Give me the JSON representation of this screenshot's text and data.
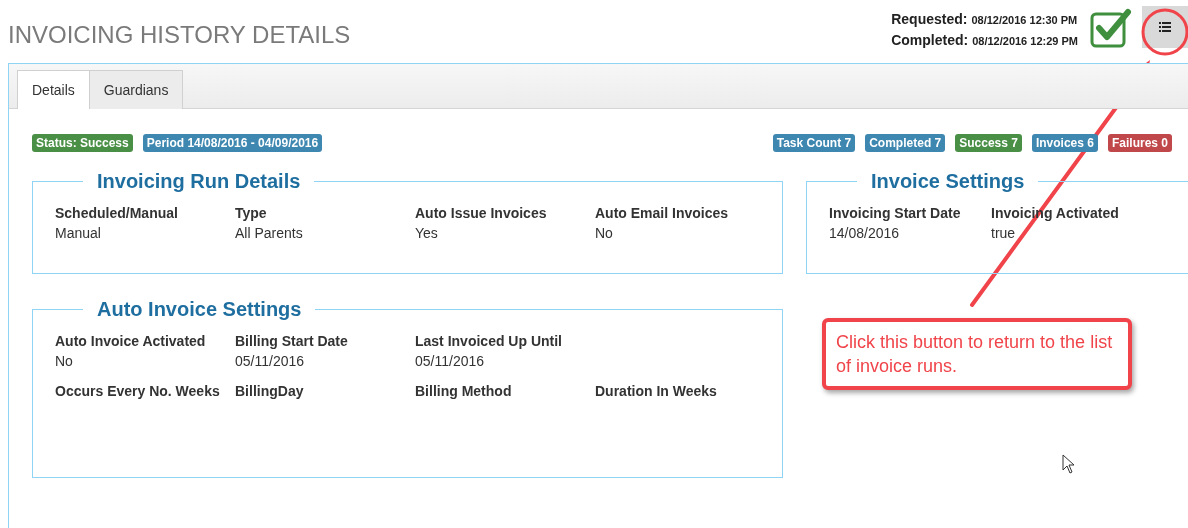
{
  "page_title": "INVOICING HISTORY DETAILS",
  "timestamps": [
    {
      "label": "Requested:",
      "value": "08/12/2016 12:30 PM"
    },
    {
      "label": "Completed:",
      "value": "08/12/2016 12:29 PM"
    }
  ],
  "tabs": [
    {
      "label": "Details",
      "selected": true
    },
    {
      "label": "Guardians",
      "selected": false
    }
  ],
  "status_badges": [
    {
      "text": "Status: Success",
      "color": "#4a8f46"
    },
    {
      "text": "Period 14/08/2016 - 04/09/2016",
      "color": "#3e87b0"
    }
  ],
  "count_badges": [
    {
      "text": "Task Count 7",
      "color": "#3e87b0"
    },
    {
      "text": "Completed 7",
      "color": "#3e87b0"
    },
    {
      "text": "Success 7",
      "color": "#4a8f46"
    },
    {
      "text": "Invoices 6",
      "color": "#3e87b0"
    },
    {
      "text": "Failures 0",
      "color": "#c0474a"
    }
  ],
  "left_sections": [
    {
      "title": "Invoicing Run Details",
      "rows": [
        [
          {
            "label": "Scheduled/Manual",
            "value": "Manual"
          },
          {
            "label": "Type",
            "value": "All Parents"
          },
          {
            "label": "Auto Issue Invoices",
            "value": "Yes"
          },
          {
            "label": "Auto Email Invoices",
            "value": "No"
          }
        ]
      ]
    },
    {
      "title": "Auto Invoice Settings",
      "rows": [
        [
          {
            "label": "Auto Invoice Activated",
            "value": "No"
          },
          {
            "label": "Billing Start Date",
            "value": "05/11/2016"
          },
          {
            "label": "Last Invoiced Up Until",
            "value": "05/11/2016"
          }
        ],
        [
          {
            "label": "Occurs Every No. Weeks"
          },
          {
            "label": "BillingDay"
          },
          {
            "label": "Billing Method"
          },
          {
            "label": "Duration In Weeks"
          }
        ]
      ]
    }
  ],
  "right_sections": [
    {
      "title": "Invoice Settings",
      "rows": [
        [
          {
            "label": "Invoicing Start Date",
            "value": "14/08/2016"
          },
          {
            "label": "Invoicing Activated",
            "value": "true"
          }
        ]
      ]
    }
  ],
  "callout": {
    "text": "Click this button to return to the list of invoice runs."
  }
}
